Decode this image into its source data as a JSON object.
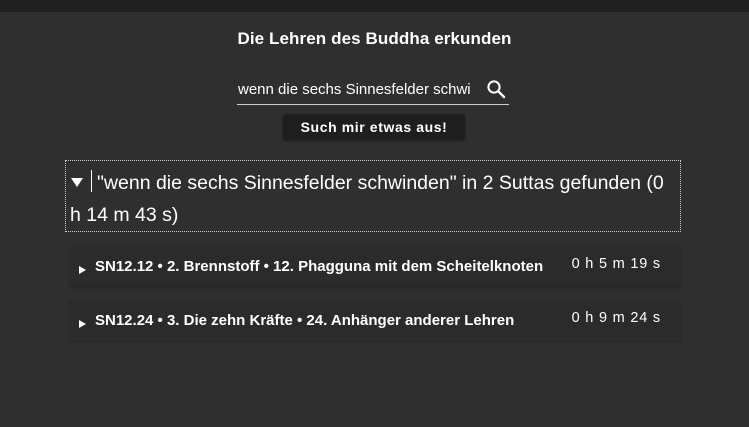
{
  "header": {
    "title": "Die Lehren des Buddha erkunden"
  },
  "search": {
    "value": "wenn die sechs Sinnesfelder schwi",
    "icon": "search-icon"
  },
  "random_button": {
    "label": "Such mir etwas aus!"
  },
  "summary": {
    "text": "\"wenn die sechs Sinnesfelder schwinden\" in 2 Suttas gefunden (0 h 14 m 43 s)",
    "toggle_icon": "triangle-down-icon"
  },
  "results": [
    {
      "label": "SN12.12 • 2. Brennstoff • 12. Phagguna mit dem Scheitelknoten",
      "duration": "0 h 5 m 19 s"
    },
    {
      "label": "SN12.24 • 3. Die zehn Kräfte • 24. Anhänger anderer Lehren",
      "duration": "0 h 9 m 24 s"
    }
  ],
  "colors": {
    "background": "#2f2f2f",
    "topbar": "#212121",
    "button": "#1e1e1e",
    "text": "#ffffff"
  }
}
